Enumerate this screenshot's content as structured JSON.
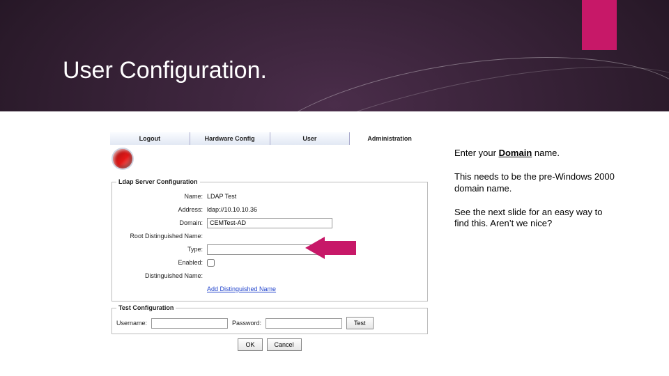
{
  "slide": {
    "title": "User Configuration."
  },
  "admin": {
    "tabs": {
      "logout": "Logout",
      "hardware": "Hardware Config",
      "user": "User",
      "administration": "Administration"
    },
    "legend_ldap": "Ldap Server Configuration",
    "legend_test": "Test Configuration",
    "labels": {
      "name": "Name:",
      "address": "Address:",
      "domain": "Domain:",
      "root_dn": "Root Distinguished Name:",
      "type": "Type:",
      "enabled": "Enabled:",
      "dn": "Distinguished Name:",
      "add_dn_link": "Add Distinguished Name",
      "username": "Username:",
      "password": "Password:"
    },
    "values": {
      "name": "LDAP Test",
      "address": "ldap://10.10.10.36",
      "domain": "CEMTest-AD",
      "root_dn": "",
      "type": "",
      "enabled": false
    },
    "buttons": {
      "test": "Test",
      "ok": "OK",
      "cancel": "Cancel"
    }
  },
  "notes": {
    "p1_prefix": "Enter your ",
    "p1_underlined": "Domain",
    "p1_suffix": " name.",
    "p2": "This needs to be the pre-Windows 2000 domain name.",
    "p3": "See the next slide for an easy way to find this. Aren’t we nice?"
  }
}
